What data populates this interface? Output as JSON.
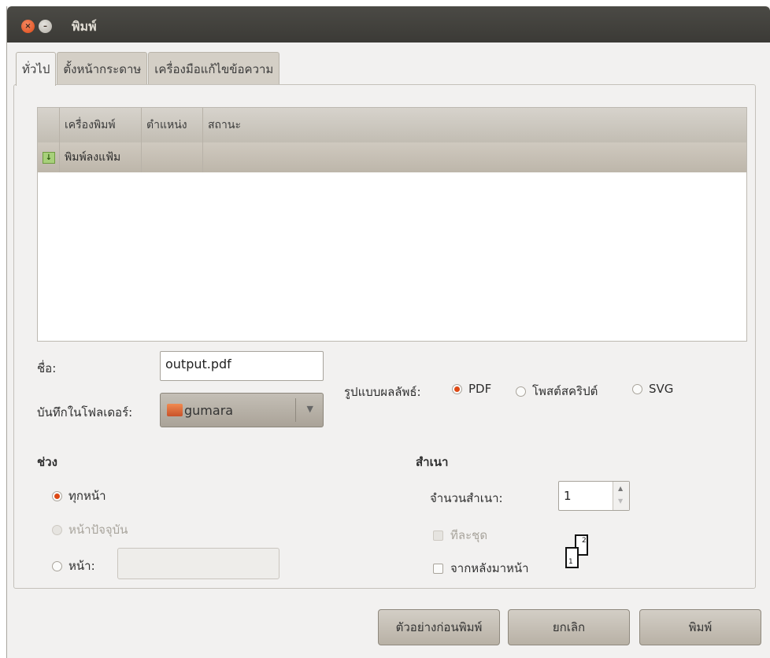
{
  "window": {
    "title": "พิมพ์"
  },
  "tabs": [
    {
      "label": "ทั่วไป",
      "active": true
    },
    {
      "label": "ตั้งหน้ากระดาษ",
      "active": false
    },
    {
      "label": "เครื่องมือแก้ไขข้อความ",
      "active": false
    }
  ],
  "printers": {
    "columns": [
      "เครื่องพิมพ์",
      "ตำแหน่ง",
      "สถานะ"
    ],
    "rows": [
      {
        "name": "พิมพ์ลงแฟ้ม",
        "location": "",
        "status": ""
      }
    ]
  },
  "file": {
    "name_label": "ชื่อ:",
    "name_value": "output.pdf",
    "folder_label": "บันทึกในโฟลเดอร์:",
    "folder_value": "gumara"
  },
  "output_format": {
    "label": "รูปแบบผลลัพธ์:",
    "options": [
      "PDF",
      "โพสต์สคริปต์",
      "SVG"
    ],
    "selected": "PDF"
  },
  "range": {
    "heading": "ช่วง",
    "all_pages": "ทุกหน้า",
    "current_page": "หน้าปัจจุบัน",
    "pages": "หน้า:",
    "pages_value": ""
  },
  "copies": {
    "heading": "สำเนา",
    "count_label": "จำนวนสำเนา:",
    "count_value": "1",
    "collate": "ทีละชุด",
    "reverse": "จากหลังมาหน้า"
  },
  "buttons": {
    "preview": "ตัวอย่างก่อนพิมพ์",
    "cancel": "ยกเลิก",
    "print": "พิมพ์"
  },
  "colors": {
    "accent": "#dd4814",
    "titlebar": "#3c3b37"
  }
}
